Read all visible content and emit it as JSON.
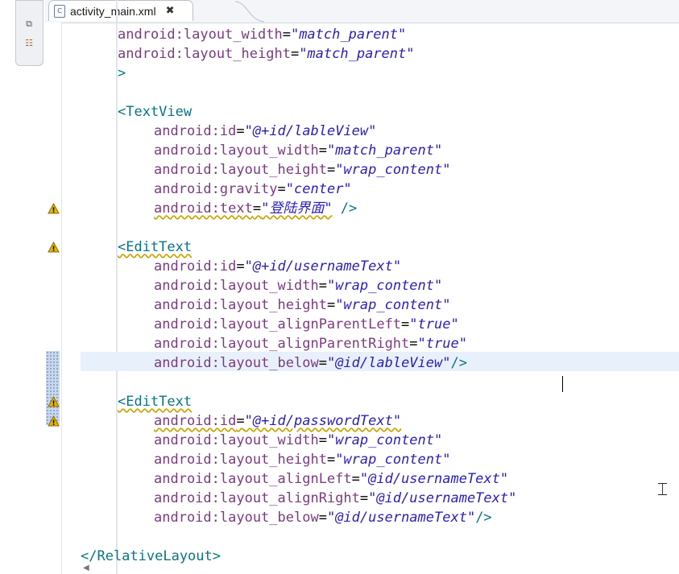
{
  "tab": {
    "title": "activity_main.xml",
    "file_icon": "xml-file-icon",
    "close_icon": "close-icon"
  },
  "toolbar": {
    "icons": [
      "restore-icon",
      "outline-icon"
    ]
  },
  "editor": {
    "lines": [
      {
        "indent": 1,
        "parts": [
          [
            "a",
            "android:layout_width"
          ],
          [
            "p",
            "="
          ],
          [
            "v",
            "\"match_parent\""
          ]
        ]
      },
      {
        "indent": 1,
        "parts": [
          [
            "a",
            "android:layout_height"
          ],
          [
            "p",
            "="
          ],
          [
            "v",
            "\"match_parent\""
          ]
        ]
      },
      {
        "indent": 1,
        "parts": [
          [
            "k",
            ">"
          ]
        ]
      },
      {
        "indent": 0,
        "parts": []
      },
      {
        "indent": 1,
        "parts": [
          [
            "k",
            "<TextView"
          ]
        ]
      },
      {
        "indent": 2,
        "parts": [
          [
            "a",
            "android:id"
          ],
          [
            "p",
            "="
          ],
          [
            "v",
            "\"@+id/lableView\""
          ]
        ]
      },
      {
        "indent": 2,
        "parts": [
          [
            "a",
            "android:layout_width"
          ],
          [
            "p",
            "="
          ],
          [
            "v",
            "\"match_parent\""
          ]
        ]
      },
      {
        "indent": 2,
        "parts": [
          [
            "a",
            "android:layout_height"
          ],
          [
            "p",
            "="
          ],
          [
            "v",
            "\"wrap_content\""
          ]
        ]
      },
      {
        "indent": 2,
        "parts": [
          [
            "a",
            "android:gravity"
          ],
          [
            "p",
            "="
          ],
          [
            "v",
            "\"center\""
          ]
        ]
      },
      {
        "indent": 2,
        "warn": true,
        "parts": [
          [
            "a",
            "android:text"
          ],
          [
            "p",
            "="
          ],
          [
            "v",
            "\"登陆界面\""
          ],
          [
            "k",
            " />"
          ]
        ]
      },
      {
        "indent": 0,
        "parts": []
      },
      {
        "indent": 1,
        "warnTag": true,
        "parts": [
          [
            "k",
            "<EditText"
          ]
        ]
      },
      {
        "indent": 2,
        "parts": [
          [
            "a",
            "android:id"
          ],
          [
            "p",
            "="
          ],
          [
            "v",
            "\"@+id/usernameText\""
          ]
        ]
      },
      {
        "indent": 2,
        "parts": [
          [
            "a",
            "android:layout_width"
          ],
          [
            "p",
            "="
          ],
          [
            "v",
            "\"wrap_content\""
          ]
        ]
      },
      {
        "indent": 2,
        "parts": [
          [
            "a",
            "android:layout_height"
          ],
          [
            "p",
            "="
          ],
          [
            "v",
            "\"wrap_content\""
          ]
        ]
      },
      {
        "indent": 2,
        "parts": [
          [
            "a",
            "android:layout_alignParentLeft"
          ],
          [
            "p",
            "="
          ],
          [
            "v",
            "\"true\""
          ]
        ]
      },
      {
        "indent": 2,
        "parts": [
          [
            "a",
            "android:layout_alignParentRight"
          ],
          [
            "p",
            "="
          ],
          [
            "v",
            "\"true\""
          ]
        ]
      },
      {
        "indent": 2,
        "parts": [
          [
            "a",
            "android:layout_below"
          ],
          [
            "p",
            "="
          ],
          [
            "v",
            "\"@id/lableView\""
          ],
          [
            "k",
            "/>"
          ]
        ]
      },
      {
        "indent": 0,
        "parts": []
      },
      {
        "indent": 1,
        "warnTag": true,
        "parts": [
          [
            "k",
            "<EditText"
          ]
        ]
      },
      {
        "indent": 2,
        "warn": true,
        "parts": [
          [
            "a",
            "android:id"
          ],
          [
            "p",
            "="
          ],
          [
            "v",
            "\"@+id/passwordText\""
          ]
        ]
      },
      {
        "indent": 2,
        "parts": [
          [
            "a",
            "android:layout_width"
          ],
          [
            "p",
            "="
          ],
          [
            "v",
            "\"wrap_content\""
          ]
        ]
      },
      {
        "indent": 2,
        "parts": [
          [
            "a",
            "android:layout_height"
          ],
          [
            "p",
            "="
          ],
          [
            "v",
            "\"wrap_content\""
          ]
        ]
      },
      {
        "indent": 2,
        "parts": [
          [
            "a",
            "android:layout_alignLeft"
          ],
          [
            "p",
            "="
          ],
          [
            "v",
            "\"@id/usernameText\""
          ]
        ]
      },
      {
        "indent": 2,
        "parts": [
          [
            "a",
            "android:layout_alignRight"
          ],
          [
            "p",
            "="
          ],
          [
            "v",
            "\"@id/usernameText\""
          ]
        ]
      },
      {
        "indent": 2,
        "parts": [
          [
            "a",
            "android:layout_below"
          ],
          [
            "p",
            "="
          ],
          [
            "v",
            "\"@id/usernameText\""
          ],
          [
            "k",
            "/>"
          ]
        ]
      },
      {
        "indent": 0,
        "parts": []
      },
      {
        "indent": 0,
        "parts": [
          [
            "k",
            "</RelativeLayout>"
          ]
        ]
      }
    ]
  },
  "gutter": {
    "warning_icon": "warning-icon"
  },
  "colors": {
    "tag": "#087484",
    "attr": "#7a3c7f",
    "value": "#2a1fb3",
    "current_line": "#e8f0fb",
    "warning": "#e3b40a"
  }
}
